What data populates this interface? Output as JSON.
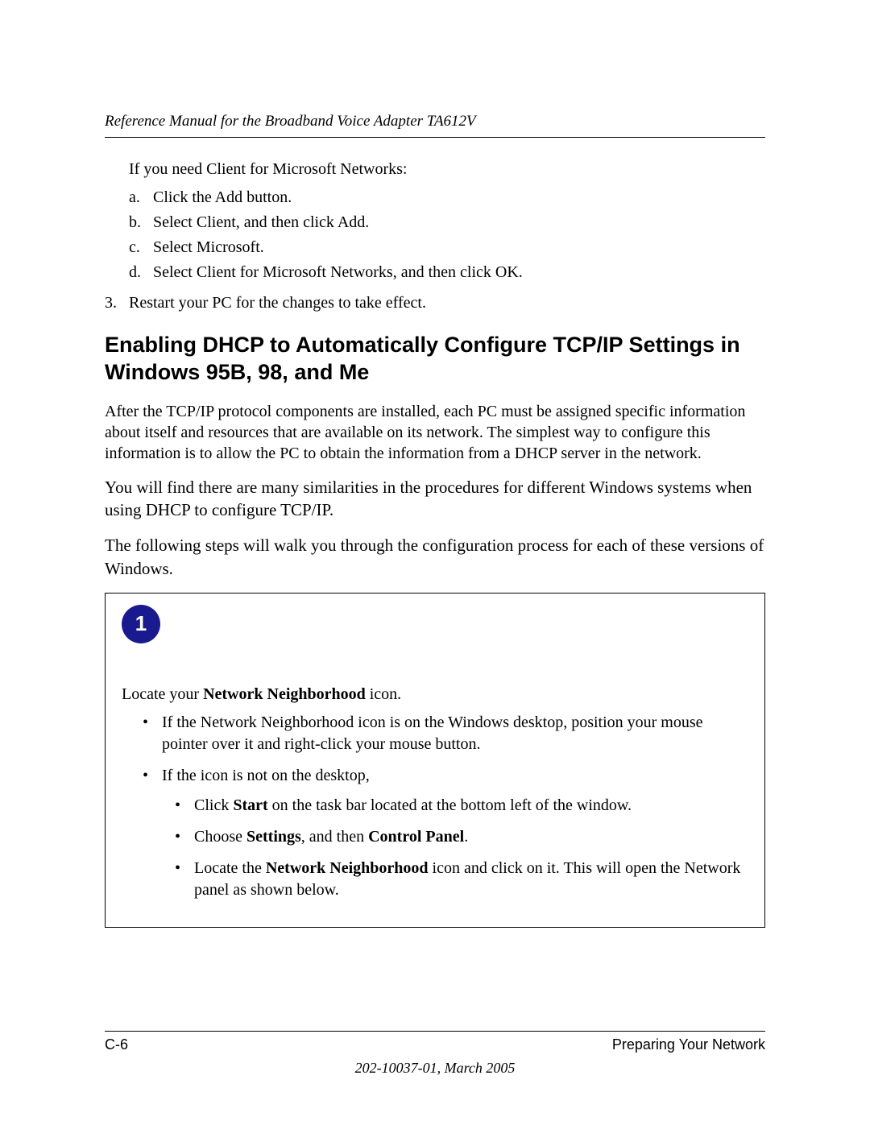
{
  "header": {
    "title": "Reference Manual for the Broadband Voice Adapter TA612V"
  },
  "body": {
    "intro_line": "If you need Client for Microsoft Networks:",
    "sub_steps": [
      "Click the Add button.",
      "Select Client, and then click Add.",
      "Select Microsoft.",
      "Select Client for Microsoft Networks, and then click OK."
    ],
    "restart_line": "Restart your PC for the changes to take effect.",
    "heading": "Enabling DHCP to Automatically Configure TCP/IP Settings in Windows 95B, 98, and Me",
    "para1": "After the TCP/IP protocol components are installed, each PC must be assigned specific information about itself and resources that are available on its network. The simplest way to configure this information is to allow the PC to obtain the information from a DHCP server in the network.",
    "para2": "You will find there are many similarities in the procedures for different Windows systems when using DHCP to configure TCP/IP.",
    "para3": "The following steps will walk you through the configuration process for each of these versions of Windows."
  },
  "step": {
    "number": "1",
    "locate_pre": "Locate your ",
    "locate_bold": "Network Neighborhood",
    "locate_post": " icon.",
    "b1": "If the Network Neighborhood icon is on the Windows desktop, position your mouse pointer over it and right-click your mouse button.",
    "b2": "If the icon is not on the desktop,",
    "i1_pre": "Click ",
    "i1_bold": "Start",
    "i1_post": " on the task bar located at the bottom left of the window.",
    "i2_pre": "Choose ",
    "i2_bold1": "Settings",
    "i2_mid": ", and then ",
    "i2_bold2": "Control Panel",
    "i2_post": ".",
    "i3_pre": "Locate the ",
    "i3_bold": "Network Neighborhood",
    "i3_post": " icon and click on it. This will open the Network panel as shown below."
  },
  "footer": {
    "page_num": "C-6",
    "section": "Preparing Your Network",
    "docinfo": "202-10037-01, March 2005"
  }
}
